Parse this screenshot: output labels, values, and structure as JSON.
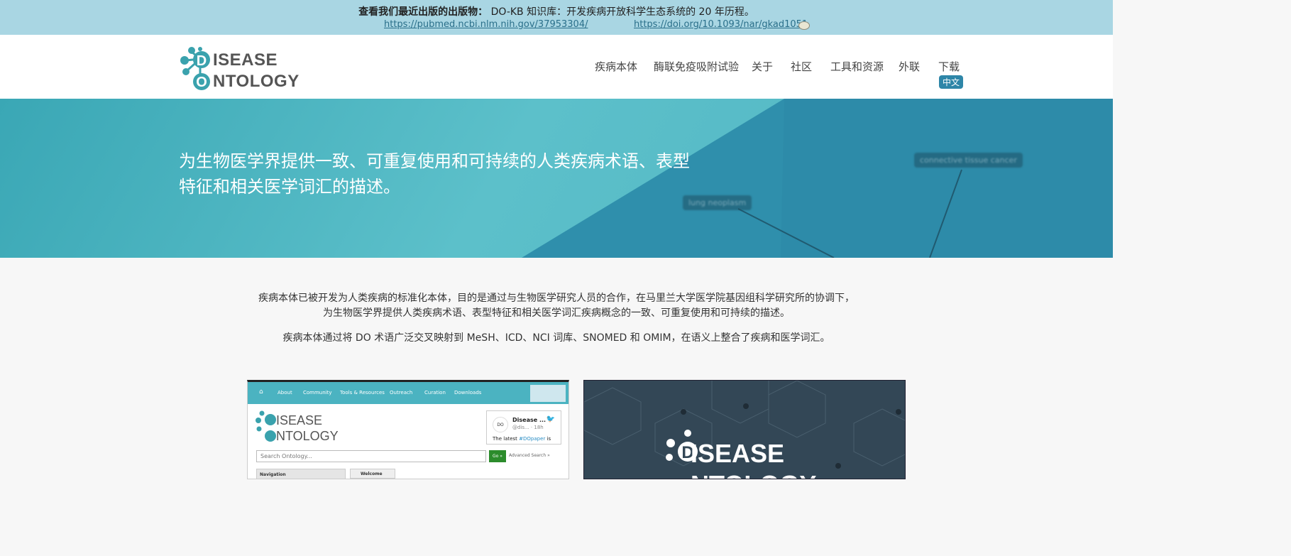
{
  "announce": {
    "lead": "查看我们最近出版的出版物：",
    "text": "DO-KB 知识库：开发疾病开放科学生态系统的 20 年历程。",
    "link1": "https://pubmed.ncbi.nlm.nih.gov/37953304/",
    "link2": "https://doi.org/10.1093/nar/gkad1051"
  },
  "logo": {
    "line1": "ISEASE",
    "line2": "NTOLOGY",
    "d_letter": "D",
    "o_letter": "O"
  },
  "nav": {
    "items": [
      "疾病本体",
      "酶联免疫吸附试验",
      "关于",
      "社区",
      "工具和资源",
      "外联",
      "下载"
    ],
    "language": "中文"
  },
  "hero": {
    "headline": "为生物医学界提供一致、可重复使用和可持续的人类疾病术语、表型特征和相关医学词汇的描述。",
    "tag1": "lung neoplasm",
    "tag2": "connective tissue cancer"
  },
  "intro": {
    "p1a": "疾病本体已被开发为人类疾病的标准化本体，目的是通过与生物医学研究人员的合作，在马里兰大学医学院基因组科学研究所的协调下，",
    "p1b": "为生物医学界提供人类疾病术语、表型特征和相关医学词汇疾病概念的一致、可重复使用和可持续的描述。",
    "p2": "疾病本体通过将 DO 术语广泛交叉映射到 MeSH、ICD、NCI 词库、SNOMED 和 OMIM，在语义上整合了疾病和医学词汇。"
  },
  "card_left": {
    "nav": [
      "About",
      "Community",
      "Tools & Resources",
      "Outreach",
      "Curation",
      "Downloads"
    ],
    "logo1": "ISEASE",
    "logo2": "NTOLOGY",
    "tweet_name": "Disease ...",
    "tweet_handle": "@dis... · 18h",
    "tweet_text": "The latest",
    "tweet_hashtag": "#DOpaper",
    "tweet_text2": "is",
    "tweet_avatar": "DO",
    "search_placeholder": "Search Ontology...",
    "go": "Go »",
    "advanced": "Advanced Search »",
    "navigation": "Navigation",
    "welcome": "Welcome"
  },
  "card_right": {
    "line1": "ISEASE",
    "line2": "NTOLOGY",
    "d_letter": "D"
  },
  "colors": {
    "accent": "#2e86a8",
    "banner": "#a9d6e3",
    "hero": "#4fb3c2"
  }
}
